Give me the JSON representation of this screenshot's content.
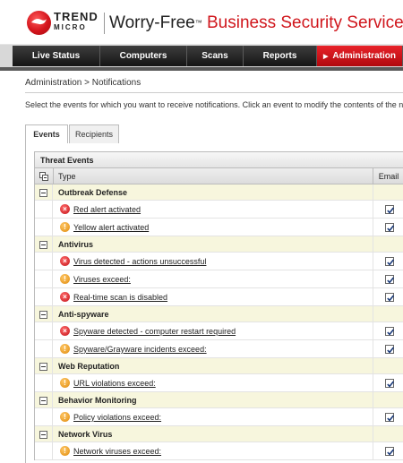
{
  "header": {
    "brand_line1": "TREND",
    "brand_line2": "MICRO",
    "product_part1": "Worry-Free",
    "trademark": "™",
    "product_part2": "Business Security Services",
    "brand_color": "#d0161c"
  },
  "nav": {
    "tabs": [
      {
        "label": "Live Status"
      },
      {
        "label": "Computers"
      },
      {
        "label": "Scans"
      },
      {
        "label": "Reports"
      },
      {
        "label": "Administration",
        "active": true
      }
    ]
  },
  "breadcrumb": "Administration > Notifications",
  "instructions": "Select the events for which you want to receive notifications. Click an event to modify the contents of the n",
  "tabs": [
    {
      "label": "Events",
      "active": true
    },
    {
      "label": "Recipients"
    }
  ],
  "table": {
    "section_title": "Threat Events",
    "col_type": "Type",
    "col_email": "Email",
    "groups": [
      {
        "name": "Outbreak Defense",
        "events": [
          {
            "label": "Red alert activated",
            "severity": "red",
            "email": true
          },
          {
            "label": "Yellow alert activated",
            "severity": "yellow",
            "email": true
          }
        ]
      },
      {
        "name": "Antivirus",
        "events": [
          {
            "label": "Virus detected - actions unsuccessful",
            "severity": "red",
            "email": true
          },
          {
            "label": "Viruses exceed:",
            "severity": "yellow",
            "email": true
          },
          {
            "label": "Real-time scan is disabled",
            "severity": "red",
            "email": true
          }
        ]
      },
      {
        "name": "Anti-spyware",
        "events": [
          {
            "label": "Spyware detected - computer restart required",
            "severity": "red",
            "email": true
          },
          {
            "label": "Spyware/Grayware incidents exceed:",
            "severity": "yellow",
            "email": true
          }
        ]
      },
      {
        "name": "Web Reputation",
        "events": [
          {
            "label": "URL violations exceed:",
            "severity": "yellow",
            "email": true
          }
        ]
      },
      {
        "name": "Behavior Monitoring",
        "events": [
          {
            "label": "Policy violations exceed:",
            "severity": "yellow",
            "email": true
          }
        ]
      },
      {
        "name": "Network Virus",
        "events": [
          {
            "label": "Network viruses exceed:",
            "severity": "yellow",
            "email": true
          }
        ]
      }
    ]
  }
}
